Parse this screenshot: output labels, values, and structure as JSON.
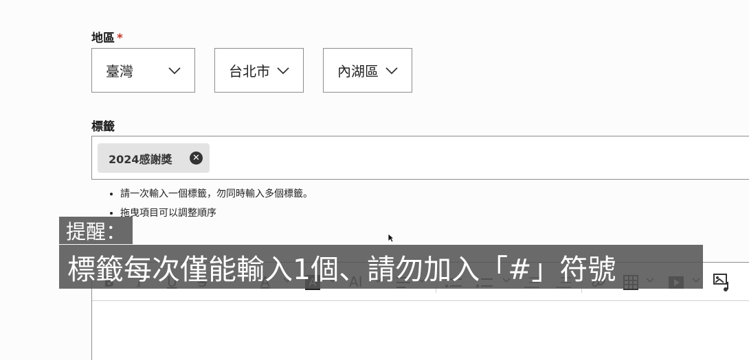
{
  "region": {
    "label": "地區",
    "required_mark": "*",
    "country": "臺灣",
    "city": "台北市",
    "district": "內湖區"
  },
  "tags": {
    "label": "標籤",
    "chips": [
      {
        "text": "2024感謝獎",
        "remove_icon": "close-circle-icon"
      }
    ],
    "hints": [
      "請一次輸入一個標籤，勿同時輸入多個標籤。",
      "拖曳項目可以調整順序"
    ]
  },
  "editor": {
    "toolbar": {
      "bold": "B",
      "italic": "I",
      "underline": "U",
      "strike": "S",
      "quote": "❝",
      "font_color": "A",
      "bg_color": "A",
      "ai": "AI"
    }
  },
  "caption": {
    "line1": "提醒：",
    "line2": "標籤每次僅能輸入1個、請勿加入「#」符號"
  }
}
